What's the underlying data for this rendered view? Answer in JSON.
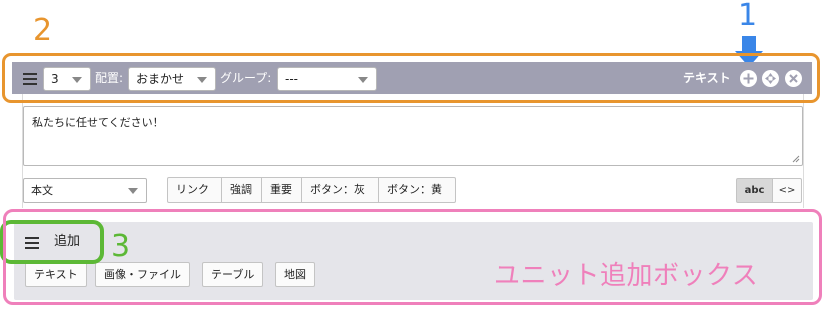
{
  "annotations": {
    "num_1": "1",
    "num_2": "2",
    "num_3": "3",
    "box_caption": "ユニット追加ボックス",
    "colors": {
      "orange": "#e8952e",
      "blue": "#3a86e8",
      "green": "#5cb836",
      "pink": "#ef80bb"
    }
  },
  "unit_header": {
    "level_value": "3",
    "placement_label": "配置:",
    "placement_value": "おまかせ",
    "group_label": "グループ:",
    "group_value": "---",
    "unit_type": "テキスト",
    "icons": [
      "plus-circle-icon",
      "move-circle-icon",
      "close-circle-icon"
    ],
    "bar_color": "#a0a0b2"
  },
  "editor": {
    "text_value": "私たちに任せてください！",
    "style_value": "本文",
    "format_buttons": [
      "リンク",
      "強調",
      "重要",
      "ボタン：灰",
      "ボタン：黄"
    ],
    "mode_abc": "abc",
    "mode_code": "<>"
  },
  "add_box": {
    "label": "追加",
    "buttons": [
      "テキスト",
      "画像・ファイル",
      "テーブル",
      "地図"
    ]
  }
}
